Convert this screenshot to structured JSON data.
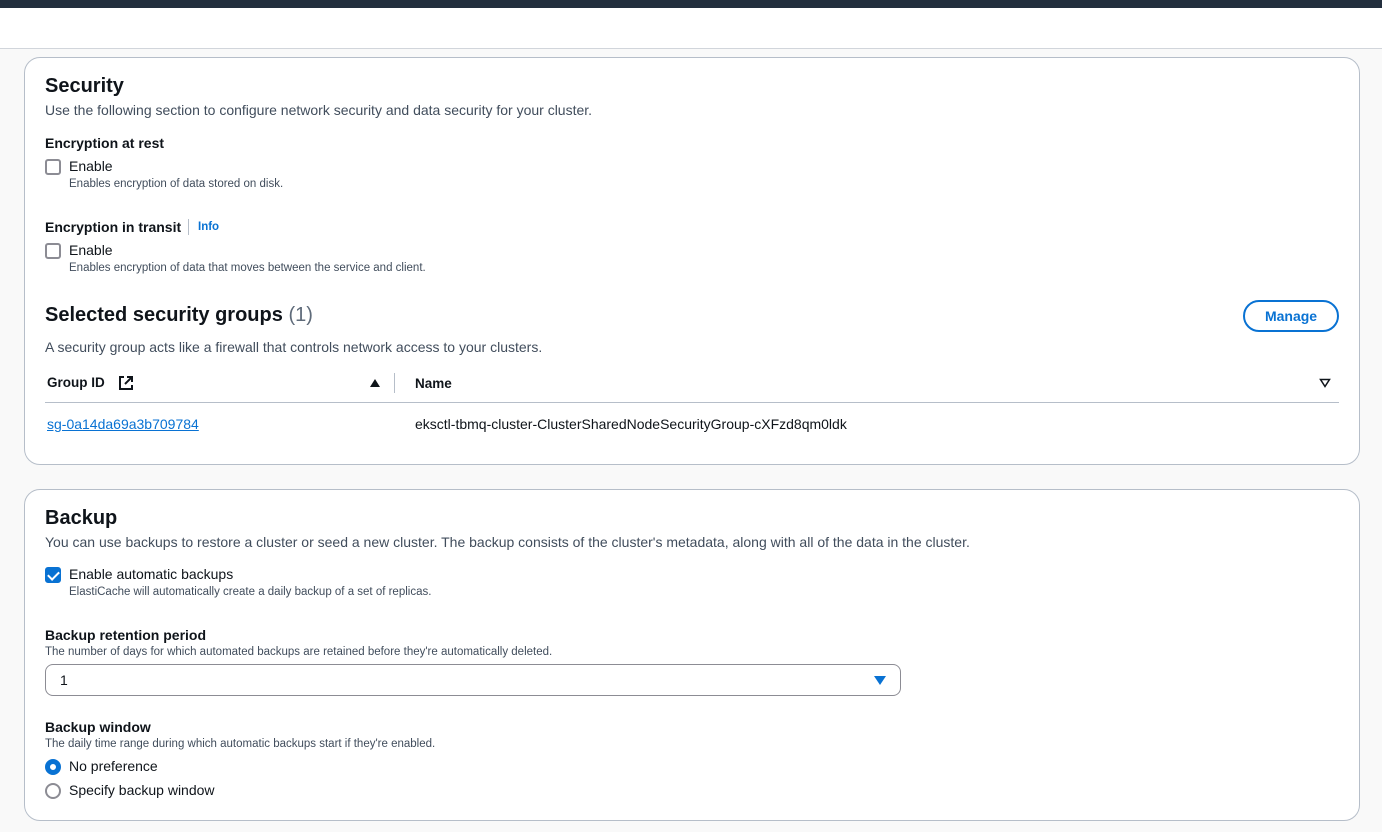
{
  "security": {
    "title": "Security",
    "description": "Use the following section to configure network security and data security for your cluster.",
    "encryption_at_rest": {
      "label": "Encryption at rest",
      "checkbox_label": "Enable",
      "checked": false,
      "help": "Enables encryption of data stored on disk."
    },
    "encryption_in_transit": {
      "label": "Encryption in transit",
      "info": "Info",
      "checkbox_label": "Enable",
      "checked": false,
      "help": "Enables encryption of data that moves between the service and client."
    }
  },
  "security_groups": {
    "title": "Selected security groups",
    "count": "(1)",
    "manage_label": "Manage",
    "description": "A security group acts like a firewall that controls network access to your clusters.",
    "columns": [
      "Group ID",
      "Name"
    ],
    "icons": {
      "external_link": "external-link-icon",
      "sort_asc": "sort-ascending-icon",
      "sort": "sort-icon"
    },
    "rows": [
      {
        "group_id": "sg-0a14da69a3b709784",
        "name": "eksctl-tbmq-cluster-ClusterSharedNodeSecurityGroup-cXFzd8qm0ldk"
      }
    ]
  },
  "backup": {
    "title": "Backup",
    "description": "You can use backups to restore a cluster or seed a new cluster. The backup consists of the cluster's metadata, along with all of the data in the cluster.",
    "auto_backup": {
      "label": "Enable automatic backups",
      "checked": true,
      "help": "ElastiCache will automatically create a daily backup of a set of replicas."
    },
    "retention": {
      "label": "Backup retention period",
      "help": "The number of days for which automated backups are retained before they're automatically deleted.",
      "value": "1"
    },
    "window": {
      "label": "Backup window",
      "help": "The daily time range during which automatic backups start if they're enabled.",
      "options": [
        "No preference",
        "Specify backup window"
      ],
      "selected": "No preference"
    }
  },
  "colors": {
    "accent": "#0972d3",
    "text": "#0f141a",
    "muted": "#414d5c",
    "border": "#b6bec9"
  }
}
